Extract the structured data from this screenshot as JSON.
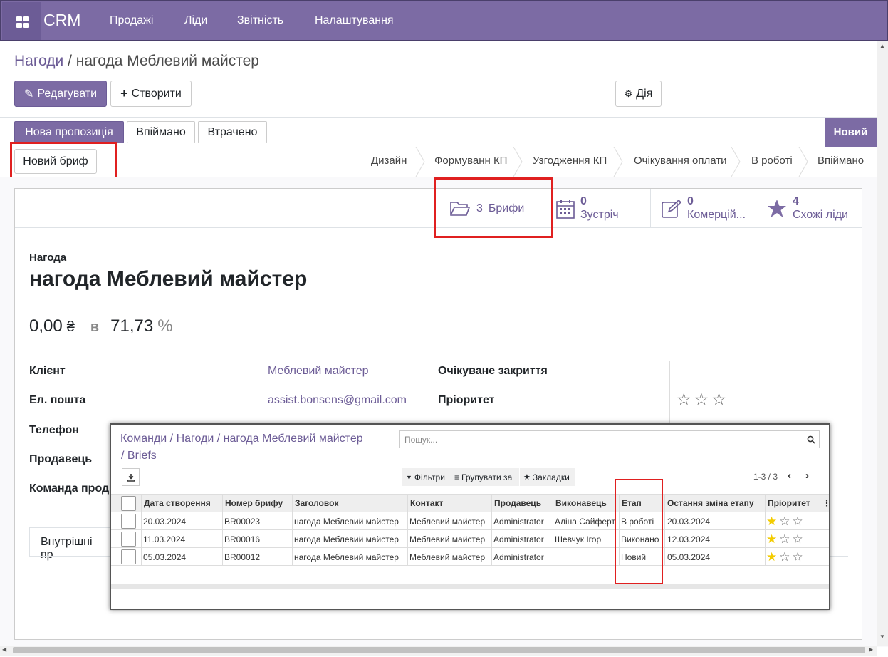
{
  "nav": {
    "brand": "CRM",
    "items": [
      "Продажі",
      "Ліди",
      "Звітність",
      "Налаштування"
    ]
  },
  "breadcrumb": {
    "root": "Нагоди",
    "separator": " / ",
    "current": "нагода Меблевий майстер"
  },
  "actions": {
    "edit": "Редагувати",
    "create": "Створити",
    "action": "Дія"
  },
  "header_buttons": [
    "Нова пропозиція",
    "Впіймано",
    "Втрачено"
  ],
  "new_brief_button": "Новий бриф",
  "stage_badge": "Новий",
  "statusbar": [
    "Дизайн",
    "Формуванн КП",
    "Узгодження КП",
    "Очікування оплати",
    "В роботі",
    "Впіймано"
  ],
  "smart_buttons": {
    "briefs": {
      "count": "3",
      "label": "Брифи"
    },
    "meetings": {
      "count": "0",
      "label": "Зустріч"
    },
    "quotes": {
      "count": "0",
      "label": "Комерцій..."
    },
    "similar": {
      "count": "4",
      "label": "Схожі ліди"
    }
  },
  "form": {
    "type_label": "Нагода",
    "title": "нагода Меблевий майстер",
    "revenue": "0,00",
    "currency": "₴",
    "at": "в",
    "probability": "71,73",
    "percent": "%",
    "client_label": "Клієнт",
    "client_value": "Меблевий майстер",
    "email_label": "Ел. пошта",
    "email_value": "assist.bonsens@gmail.com",
    "phone_label": "Телефон",
    "seller_label": "Продавець",
    "team_label": "Команда прод",
    "expected_close_label": "Очікуване закриття",
    "priority_label": "Пріоритет",
    "notes_tab": "Внутрішні пр"
  },
  "modal": {
    "breadcrumb_line1": "Команди / Нагоди / нагода Меблевий майстер",
    "breadcrumb_line2": " / Briefs",
    "search_placeholder": "Пошук...",
    "filters": "Фільтри",
    "group_by": "Групувати за",
    "favorites": "Закладки",
    "pager": "1-3 / 3",
    "columns": [
      "Дата створення",
      "Номер брифу",
      "Заголовок",
      "Контакт",
      "Продавець",
      "Виконавець",
      "Етап",
      "Остання зміна етапу",
      "Пріоритет"
    ],
    "rows": [
      {
        "date": "20.03.2024",
        "number": "BR00023",
        "title": "нагода Меблевий майстер",
        "contact": "Меблевий майстер",
        "seller": "Administrator",
        "executor": "Аліна Сайферт",
        "stage": "В роботі",
        "stage_changed": "20.03.2024",
        "priority": 1
      },
      {
        "date": "11.03.2024",
        "number": "BR00016",
        "title": "нагода Меблевий майстер",
        "contact": "Меблевий майстер",
        "seller": "Administrator",
        "executor": "Шевчук Ігор",
        "stage": "Виконано",
        "stage_changed": "12.03.2024",
        "priority": 1
      },
      {
        "date": "05.03.2024",
        "number": "BR00012",
        "title": "нагода Меблевий майстер",
        "contact": "Меблевий майстер",
        "seller": "Administrator",
        "executor": "",
        "stage": "Новий",
        "stage_changed": "05.03.2024",
        "priority": 1
      }
    ]
  },
  "colors": {
    "brand": "#7c6ba4",
    "highlight": "#e02020",
    "star": "#f3cc00"
  }
}
